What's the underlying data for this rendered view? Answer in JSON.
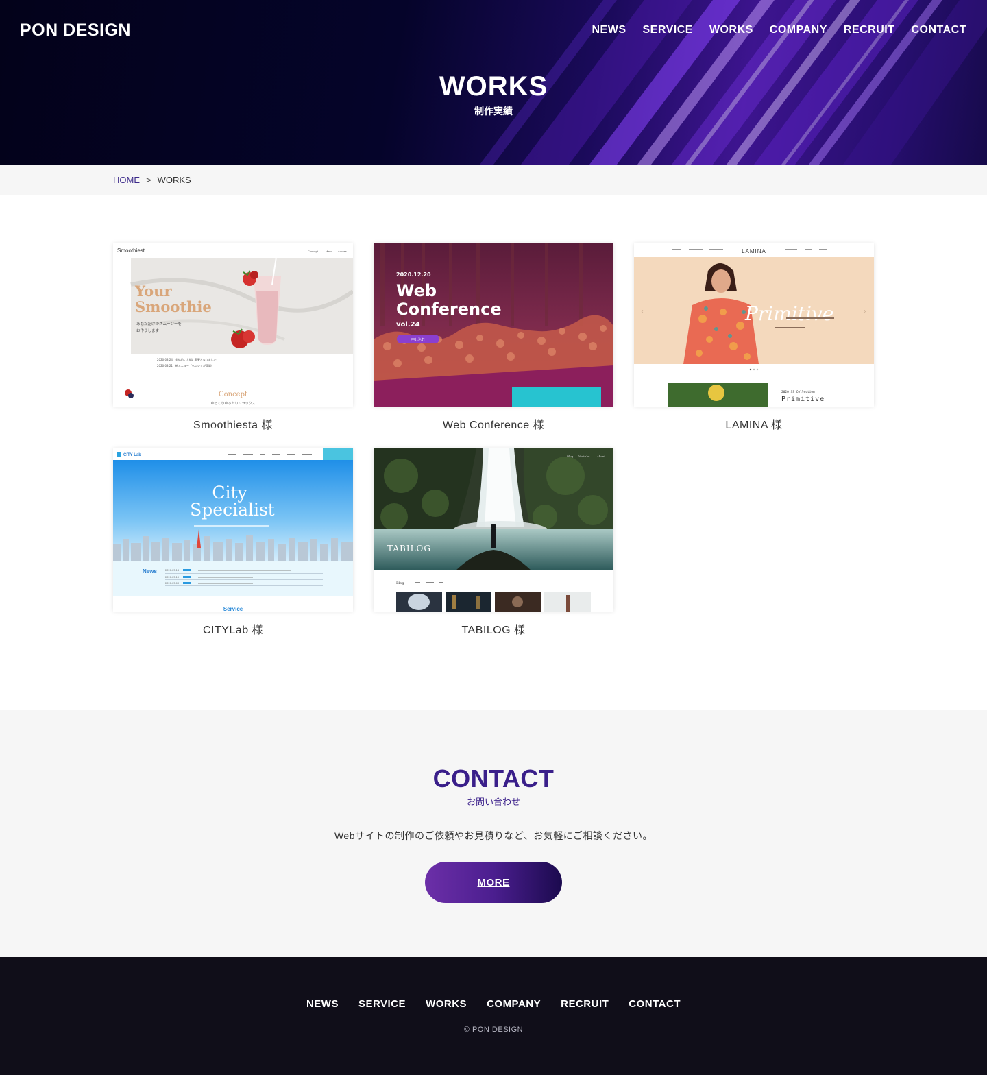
{
  "header": {
    "logo": "PON DESIGN",
    "nav": [
      "NEWS",
      "SERVICE",
      "WORKS",
      "COMPANY",
      "RECRUIT",
      "CONTACT"
    ],
    "title": "WORKS",
    "subtitle": "制作実績"
  },
  "breadcrumb": {
    "home": "HOME",
    "separator": ">",
    "current": "WORKS"
  },
  "works": [
    {
      "caption": "Smoothiesta 様",
      "thumb": {
        "brand": "Smoothiest",
        "nav": [
          "Concept",
          "Menu",
          "Access"
        ],
        "headline": [
          "Your",
          "Smoothie"
        ],
        "tagline": [
          "あなただけのスムージーを",
          "お作りします"
        ],
        "news": [
          "2020.03.24　全体的に大幅に変更となりました",
          "2020.03.21　新メニュー「ベジシ」が登場！"
        ],
        "section": "Concept",
        "section_sub": "ゆっくりゆったりリラックス"
      }
    },
    {
      "caption": "Web Conference 様",
      "thumb": {
        "date": "2020.12.20",
        "headline": [
          "Web",
          "Conference"
        ],
        "vol": "vol.24",
        "button": "申し込む"
      }
    },
    {
      "caption": "LAMINA 様",
      "thumb": {
        "brand": "LAMINA",
        "headline": "Primitive",
        "tag": "Primitive",
        "tag_sub": "2020 SS Collection"
      }
    },
    {
      "caption": "CITYLab 様",
      "thumb": {
        "brand": "CITY Lab",
        "headline": [
          "City",
          "Specialist"
        ],
        "news_title": "News",
        "news_dates": [
          "2020.03.16",
          "2020.03.10",
          "2020.03.03"
        ],
        "section": "Service"
      }
    },
    {
      "caption": "TABILOG 様",
      "thumb": {
        "brand": "TABILOG",
        "nav": [
          "Blog",
          "Youtube",
          "About"
        ],
        "section": "Blog"
      }
    }
  ],
  "contact": {
    "title": "CONTACT",
    "subtitle": "お問い合わせ",
    "message": "Webサイトの制作のご依頼やお見積りなど、お気軽にご相談ください。",
    "button": "MORE"
  },
  "footer": {
    "nav": [
      "NEWS",
      "SERVICE",
      "WORKS",
      "COMPANY",
      "RECRUIT",
      "CONTACT"
    ],
    "copyright": "© PON DESIGN"
  },
  "colors": {
    "accent": "#3a1f8a",
    "hero_dark": "#05042a",
    "hero_purple": "#6a2bd0",
    "footer": "#100e19",
    "band": "#f6f6f6"
  },
  "icons": [
    "arrow-left-icon",
    "arrow-right-icon"
  ]
}
